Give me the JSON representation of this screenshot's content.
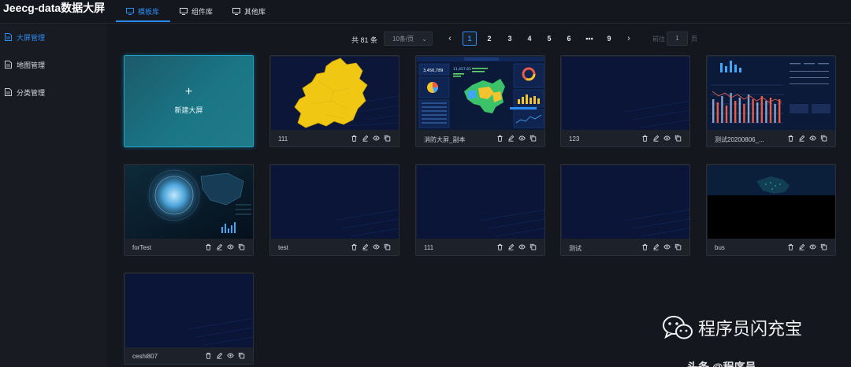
{
  "app": {
    "title": "Jeecg-data数据大屏"
  },
  "tabs": [
    {
      "label": "模板库",
      "active": true
    },
    {
      "label": "组件库",
      "active": false
    },
    {
      "label": "其他库",
      "active": false
    }
  ],
  "sidebar": {
    "items": [
      {
        "label": "大屏管理",
        "active": true
      },
      {
        "label": "地图管理",
        "active": false
      },
      {
        "label": "分类管理",
        "active": false
      }
    ]
  },
  "pagination": {
    "total_label": "共 81 条",
    "page_size": "10条/页",
    "pages": [
      "1",
      "2",
      "3",
      "4",
      "5",
      "6",
      "•••",
      "9"
    ],
    "current_page": "1",
    "goto_label": "前往",
    "goto_value": "1",
    "goto_suffix": "页"
  },
  "new_screen": {
    "plus": "+",
    "label": "新建大屏"
  },
  "cards": [
    {
      "name": "111"
    },
    {
      "name": "消防大屏_副本"
    },
    {
      "name": "123"
    },
    {
      "name": "测试20200806_..."
    },
    {
      "name": "forTest"
    },
    {
      "name": "test"
    },
    {
      "name": "111"
    },
    {
      "name": "测试"
    },
    {
      "name": "bus"
    },
    {
      "name": "ceshi807"
    }
  ],
  "thumb_labels": {
    "dashboard_value": "3,456,789",
    "dashboard_value2": "11,457.81"
  },
  "watermark": {
    "text": "程序员闪充宝",
    "partial_text": "头条 @程序员"
  },
  "colors": {
    "accent": "#2d8cf0",
    "background": "#14171e",
    "card": "#1c212a",
    "thumb_bg": "#0a1536",
    "new_card": "#1a7585"
  }
}
